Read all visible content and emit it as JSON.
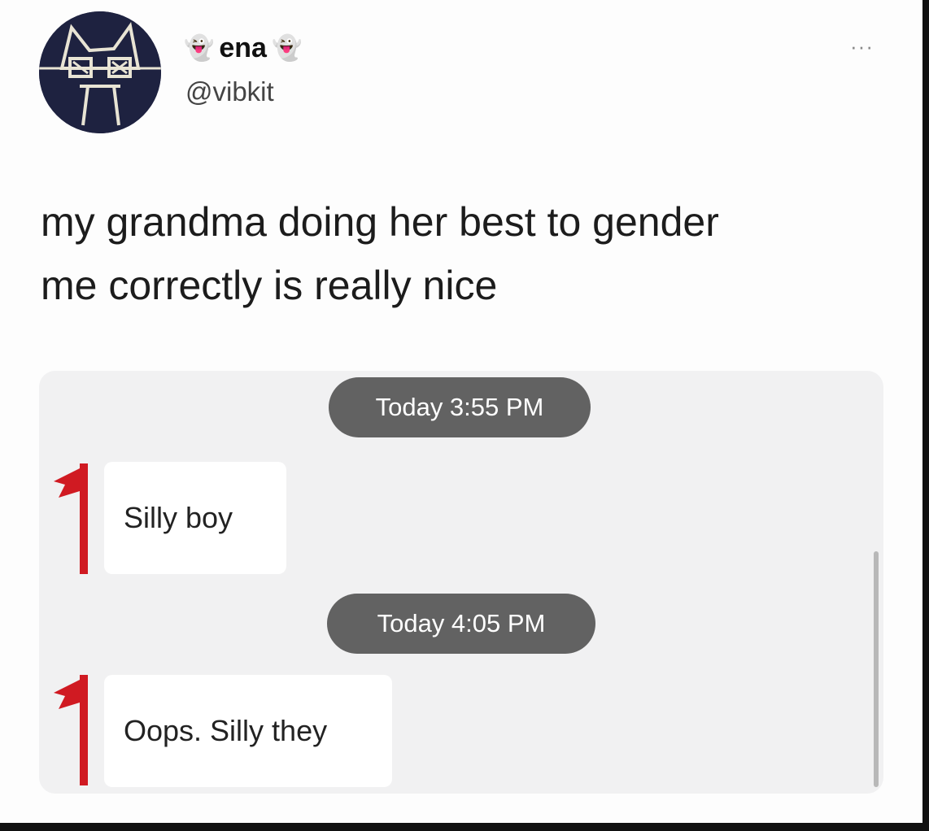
{
  "tweet": {
    "display_name": "ena",
    "name_emoji_left": "👻",
    "name_emoji_right": "👻",
    "handle": "@vibkit",
    "more_icon": "more-dots-icon",
    "text_line1": "my grandma doing her best to gender",
    "text_line2": "me correctly is really nice"
  },
  "chat": {
    "messages": [
      {
        "timestamp": "Today 3:55 PM",
        "text": "Silly boy"
      },
      {
        "timestamp": "Today 4:05 PM",
        "text": "Oops. Silly they"
      }
    ],
    "flag_icon": "red-flag-icon"
  },
  "colors": {
    "timestamp_pill": "#626262",
    "chat_background": "#f1f1f2",
    "flag_red": "#d01a22",
    "avatar_background": "#1e2240"
  }
}
